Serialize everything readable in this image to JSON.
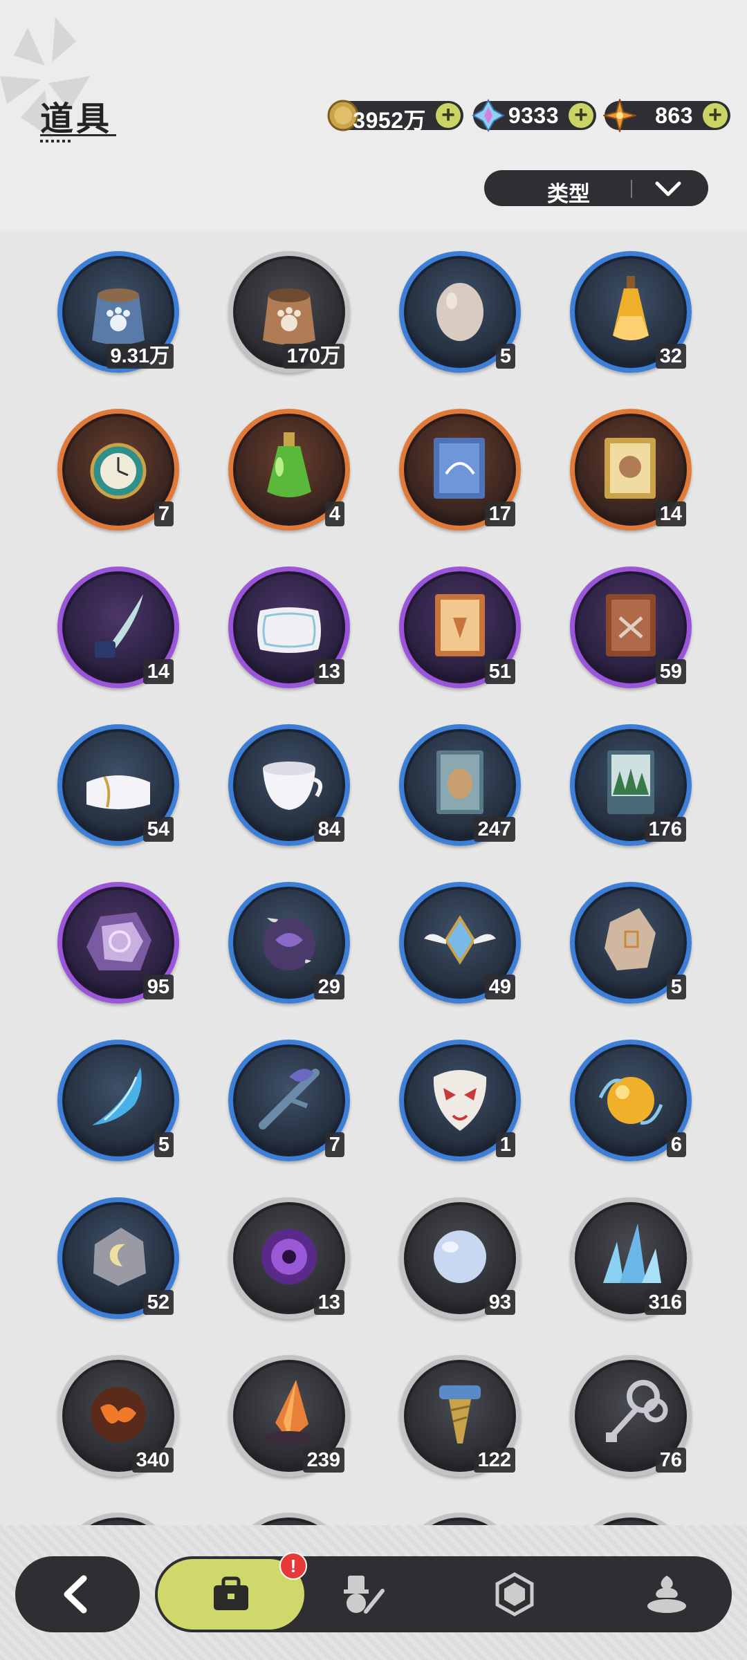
{
  "header": {
    "title": "道具"
  },
  "currencies": [
    {
      "name": "gold-coin",
      "value": "3952万",
      "plus": "+"
    },
    {
      "name": "crystal",
      "value": "9333",
      "plus": "+"
    },
    {
      "name": "star-shard",
      "value": "863",
      "plus": "+"
    }
  ],
  "filter": {
    "label": "类型"
  },
  "items": [
    {
      "icon": "paw-food-bag-blue",
      "rarity": "blue",
      "count": "9.31万"
    },
    {
      "icon": "paw-food-bag-brown",
      "rarity": "gray",
      "count": "170万"
    },
    {
      "icon": "egg",
      "rarity": "blue",
      "count": "5"
    },
    {
      "icon": "potion-vial",
      "rarity": "blue",
      "count": "32"
    },
    {
      "icon": "pocket-watch",
      "rarity": "orange",
      "count": "7"
    },
    {
      "icon": "green-potion",
      "rarity": "orange",
      "count": "4"
    },
    {
      "icon": "blue-book",
      "rarity": "orange",
      "count": "17"
    },
    {
      "icon": "gold-book",
      "rarity": "orange",
      "count": "14"
    },
    {
      "icon": "quill-ink",
      "rarity": "purple",
      "count": "14"
    },
    {
      "icon": "pillow",
      "rarity": "purple",
      "count": "13"
    },
    {
      "icon": "orange-book",
      "rarity": "purple",
      "count": "51"
    },
    {
      "icon": "brown-book",
      "rarity": "purple",
      "count": "59"
    },
    {
      "icon": "towel",
      "rarity": "blue",
      "count": "54"
    },
    {
      "icon": "teacup",
      "rarity": "blue",
      "count": "84"
    },
    {
      "icon": "seed-card",
      "rarity": "blue",
      "count": "247"
    },
    {
      "icon": "forest-card",
      "rarity": "blue",
      "count": "176"
    },
    {
      "icon": "purple-ore",
      "rarity": "purple",
      "count": "95"
    },
    {
      "icon": "dark-orb",
      "rarity": "blue",
      "count": "29"
    },
    {
      "icon": "winged-crystal",
      "rarity": "blue",
      "count": "49"
    },
    {
      "icon": "rune-stone",
      "rarity": "blue",
      "count": "5"
    },
    {
      "icon": "ice-shard",
      "rarity": "blue",
      "count": "5"
    },
    {
      "icon": "branch",
      "rarity": "blue",
      "count": "7"
    },
    {
      "icon": "fox-mask",
      "rarity": "blue",
      "count": "1"
    },
    {
      "icon": "amber-orb",
      "rarity": "blue",
      "count": "6"
    },
    {
      "icon": "moon-stone",
      "rarity": "blue",
      "count": "52"
    },
    {
      "icon": "void-core",
      "rarity": "gray",
      "count": "13"
    },
    {
      "icon": "snowball",
      "rarity": "gray",
      "count": "93"
    },
    {
      "icon": "ice-crystals",
      "rarity": "gray",
      "count": "316"
    },
    {
      "icon": "lava-rock",
      "rarity": "gray",
      "count": "340"
    },
    {
      "icon": "fire-crystal",
      "rarity": "gray",
      "count": "239"
    },
    {
      "icon": "screw",
      "rarity": "gray",
      "count": "122"
    },
    {
      "icon": "wind-key",
      "rarity": "gray",
      "count": "76"
    }
  ],
  "nav": {
    "back": "chevron-left-icon",
    "tabs": [
      "bag-icon",
      "hat-sword-icon",
      "hexagon-icon",
      "cake-icon"
    ],
    "badge": "!"
  }
}
